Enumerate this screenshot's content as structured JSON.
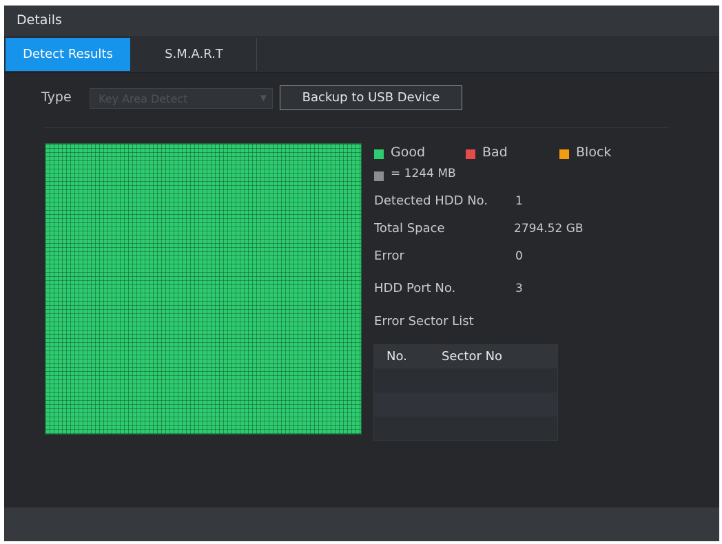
{
  "window": {
    "title": "Details"
  },
  "tabs": [
    {
      "label": "Detect Results",
      "active": true
    },
    {
      "label": "S.M.A.R.T",
      "active": false
    }
  ],
  "filter": {
    "type_label": "Type",
    "type_value": "Key Area Detect",
    "backup_button": "Backup to USB Device"
  },
  "legend": {
    "good": "Good",
    "bad": "Bad",
    "block": "Block",
    "unit": "= 1244 MB",
    "colors": {
      "good": "#2ecc71",
      "bad": "#e84a4a",
      "block": "#f39c12",
      "unit": "#8a8d91"
    }
  },
  "info": {
    "detected_hdd_label": "Detected HDD No.",
    "detected_hdd_value": "1",
    "total_space_label": "Total Space",
    "total_space_value": "2794.52 GB",
    "error_label": "Error",
    "error_value": "0",
    "hdd_port_label": "HDD Port No.",
    "hdd_port_value": "3",
    "error_sector_list_label": "Error Sector List"
  },
  "sector_table": {
    "columns": [
      "No.",
      "Sector No"
    ],
    "rows": []
  }
}
